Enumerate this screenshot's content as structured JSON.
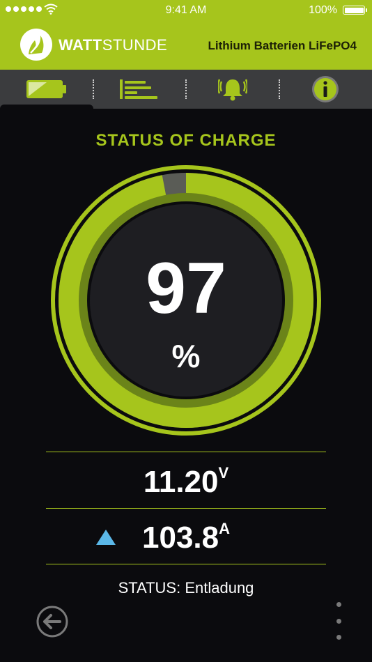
{
  "status_bar": {
    "time": "9:41 AM",
    "battery_percent": "100%",
    "signal_icon": "signal-dots-icon",
    "wifi_icon": "wifi-icon",
    "battery_icon": "battery-icon"
  },
  "header": {
    "brand_bold": "WATT",
    "brand_light": "STUNDE",
    "product_title": "Lithium Batterien LiFePO4",
    "logo_icon": "wattstunde-logo-icon",
    "background_color": "#a6c51c"
  },
  "tabs": [
    {
      "icon": "battery-tab-icon",
      "active": true
    },
    {
      "icon": "list-bars-icon",
      "active": false
    },
    {
      "icon": "alarm-bell-icon",
      "active": false
    },
    {
      "icon": "info-icon",
      "active": false
    }
  ],
  "main": {
    "title": "STATUS OF CHARGE",
    "charge_value": "97",
    "charge_unit": "%",
    "charge_fraction": 0.97,
    "voltage_value": "11.20",
    "voltage_unit": "V",
    "current_value": "103.8",
    "current_unit": "A",
    "current_direction_icon": "arrow-up-icon",
    "status_text": "STATUS: Entladung",
    "accent_color": "#a6c51c",
    "arrow_color": "#5bb8e8"
  },
  "footer": {
    "back_icon": "back-arrow-icon",
    "more_icon": "more-vertical-icon"
  }
}
